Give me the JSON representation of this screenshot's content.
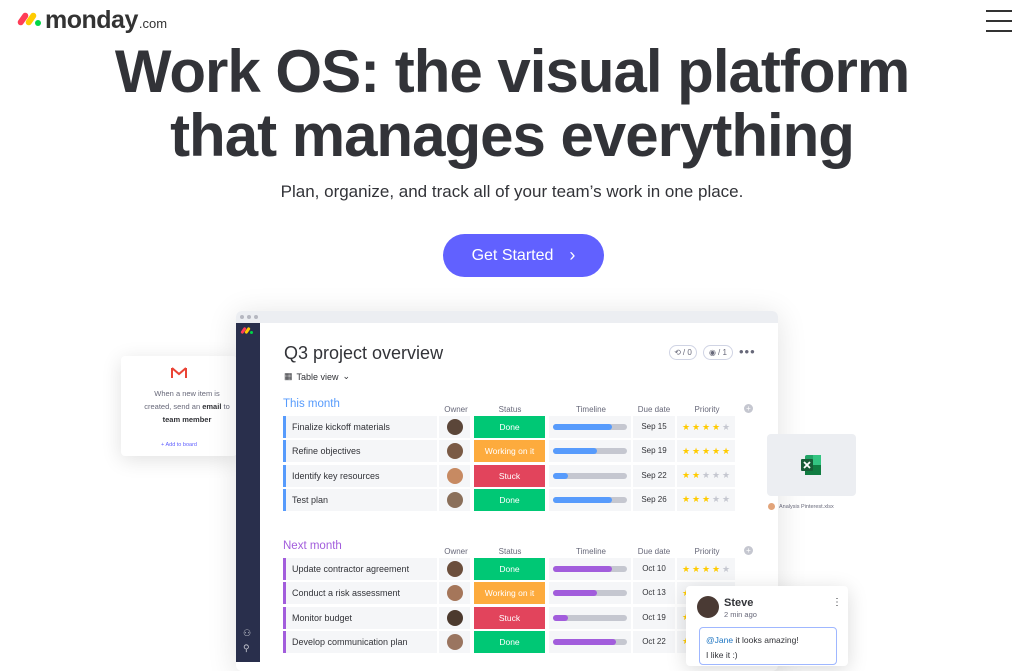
{
  "header": {
    "logo_text": "monday",
    "logo_suffix": ".com",
    "logo_colors": [
      "#ff3d57",
      "#ffcb00",
      "#00d647"
    ],
    "menu_icon": "hamburger-icon"
  },
  "hero": {
    "title_line1": "Work OS: the visual platform",
    "title_line2": "that manages everything",
    "subtitle": "Plan, organize, and track all of your team’s work in one place.",
    "cta_label": "Get Started",
    "cta_icon": "chevron-right-icon",
    "cta_color": "#6161ff"
  },
  "board": {
    "title": "Q3 project overview",
    "view_label": "Table view",
    "view_icon": "table-icon",
    "activity_count": "/ 0",
    "viewers_count": "/ 1",
    "columns": [
      "Owner",
      "Status",
      "Timeline",
      "Due date",
      "Priority"
    ],
    "groups": [
      {
        "title": "This month",
        "color": "#579bfc",
        "rows": [
          {
            "name": "Finalize kickoff materials",
            "status": "Done",
            "status_color": "#00c875",
            "timeline_fill": 0.8,
            "due": "Sep 15",
            "priority": 4
          },
          {
            "name": "Refine objectives",
            "status": "Working on it",
            "status_color": "#fdab3d",
            "timeline_fill": 0.6,
            "due": "Sep 19",
            "priority": 5
          },
          {
            "name": "Identify key resources",
            "status": "Stuck",
            "status_color": "#e2445c",
            "timeline_fill": 0.2,
            "due": "Sep 22",
            "priority": 2
          },
          {
            "name": "Test plan",
            "status": "Done",
            "status_color": "#00c875",
            "timeline_fill": 0.8,
            "due": "Sep 26",
            "priority": 3
          }
        ]
      },
      {
        "title": "Next month",
        "color": "#a25ddc",
        "rows": [
          {
            "name": "Update contractor agreement",
            "status": "Done",
            "status_color": "#00c875",
            "timeline_fill": 0.8,
            "due": "Oct 10",
            "priority": 4
          },
          {
            "name": "Conduct a risk assessment",
            "status": "Working on it",
            "status_color": "#fdab3d",
            "timeline_fill": 0.6,
            "due": "Oct 13",
            "priority": 3
          },
          {
            "name": "Monitor budget",
            "status": "Stuck",
            "status_color": "#e2445c",
            "timeline_fill": 0.2,
            "due": "Oct 19",
            "priority": 4
          },
          {
            "name": "Develop communication plan",
            "status": "Done",
            "status_color": "#00c875",
            "timeline_fill": 0.85,
            "due": "Oct 22",
            "priority": 2
          }
        ]
      }
    ],
    "timeline_color_group1": "#579bfc",
    "timeline_color_group2": "#a25ddc",
    "star_color": "#ffcb00",
    "star_empty_color": "#c5c7d0"
  },
  "gmail_card": {
    "icon": "gmail-icon",
    "line1": "When a new item is",
    "line2_prefix": "created, send an ",
    "line2_bold": "email",
    "line2_suffix": " to",
    "line3": "team member",
    "link": "+ Add to board"
  },
  "excel_card": {
    "icon": "excel-icon",
    "caption": "Analysis Pinterest.xlsx"
  },
  "comment_card": {
    "name": "Steve",
    "time": "2 min ago",
    "mention": "@Jane",
    "text_rest": " it looks amazing!",
    "text_line2": "I like it :)"
  }
}
